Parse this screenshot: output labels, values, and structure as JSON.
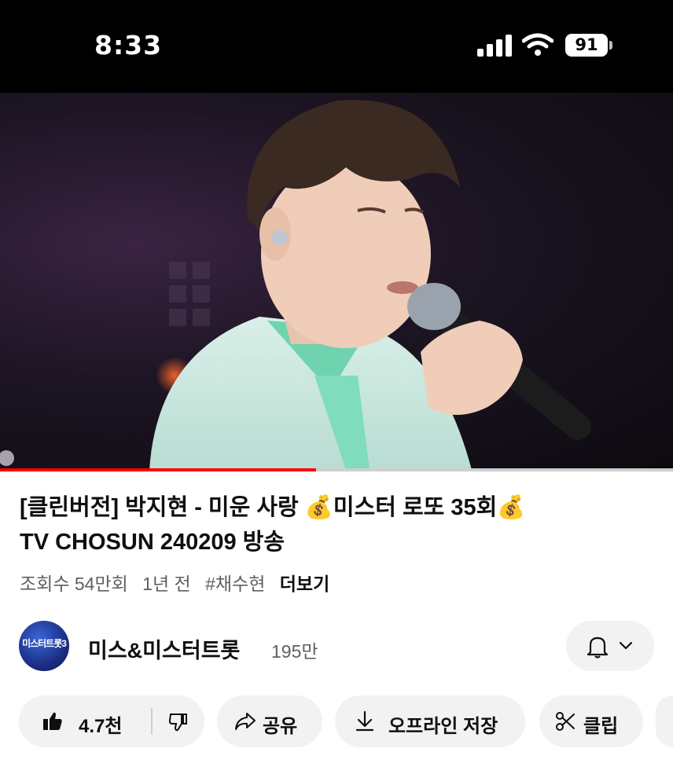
{
  "status_bar": {
    "time": "8:33",
    "battery": "91"
  },
  "video": {
    "progress_fraction": 0.47
  },
  "title": {
    "line1": "[클린버전] 박지현 - 미운 사랑 💰미스터 로또 35회💰",
    "line2": "TV CHOSUN 240209 방송"
  },
  "meta": {
    "views": "조회수 54만회",
    "age": "1년 전",
    "hashtag": "#채수현",
    "more": "더보기"
  },
  "channel": {
    "name": "미스&미스터트롯",
    "subscribers": "195만",
    "avatar_text": "미스터트롯3"
  },
  "actions": {
    "likes": "4.7천",
    "share": "공유",
    "download": "오프라인 저장",
    "clip": "클립"
  },
  "icons": [
    "signal-icon",
    "wifi-icon",
    "battery-icon",
    "bell-icon",
    "chevron-down-icon",
    "thumbs-up-icon",
    "thumbs-down-icon",
    "share-icon",
    "download-icon",
    "scissors-icon"
  ]
}
